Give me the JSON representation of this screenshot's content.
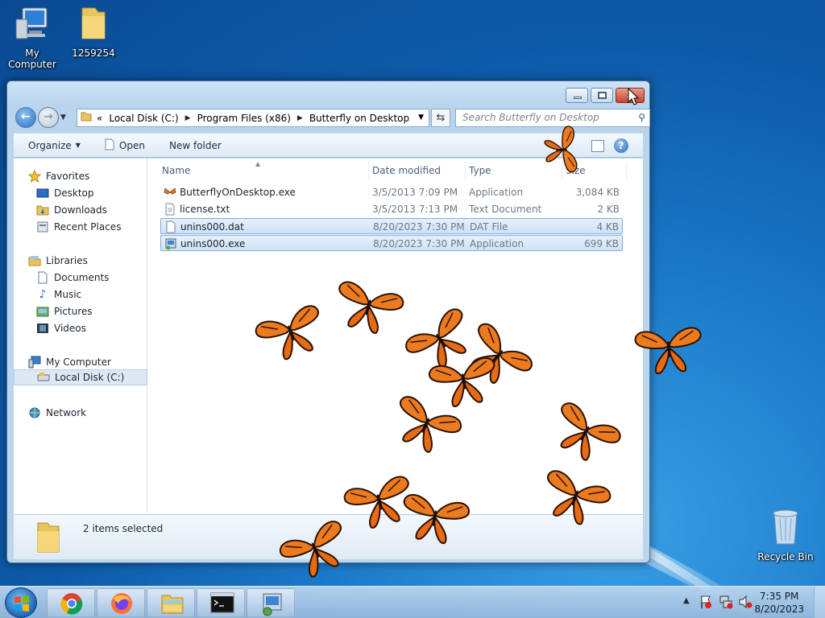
{
  "desktop": {
    "icons": [
      {
        "label": "My Computer",
        "icon": "computer-icon"
      },
      {
        "label": "1259254",
        "icon": "folder-icon"
      },
      {
        "label": "Recycle Bin",
        "icon": "recycle-bin-icon"
      }
    ]
  },
  "window": {
    "address": {
      "overflow": "«",
      "segments": [
        "Local Disk (C:)",
        "Program Files (x86)",
        "Butterfly on Desktop"
      ]
    },
    "search": {
      "placeholder": "Search Butterfly on Desktop"
    },
    "toolbar": {
      "organize": "Organize",
      "open": "Open",
      "new_folder": "New folder"
    },
    "nav": {
      "favorites": "Favorites",
      "desktop": "Desktop",
      "downloads": "Downloads",
      "recent": "Recent Places",
      "libraries": "Libraries",
      "documents": "Documents",
      "music": "Music",
      "pictures": "Pictures",
      "videos": "Videos",
      "computer": "My Computer",
      "local_disk": "Local Disk (C:)",
      "network": "Network"
    },
    "columns": {
      "name": "Name",
      "date": "Date modified",
      "type": "Type",
      "size": "Size"
    },
    "files": [
      {
        "name": "ButterflyOnDesktop.exe",
        "date": "3/5/2013 7:09 PM",
        "type": "Application",
        "size": "3,084 KB",
        "icon": "butterfly-app-icon",
        "selected": false
      },
      {
        "name": "license.txt",
        "date": "3/5/2013 7:13 PM",
        "type": "Text Document",
        "size": "2 KB",
        "icon": "text-file-icon",
        "selected": false
      },
      {
        "name": "unins000.dat",
        "date": "8/20/2023 7:30 PM",
        "type": "DAT File",
        "size": "4 KB",
        "icon": "file-icon",
        "selected": true
      },
      {
        "name": "unins000.exe",
        "date": "8/20/2023 7:30 PM",
        "type": "Application",
        "size": "699 KB",
        "icon": "installer-icon",
        "selected": true
      }
    ],
    "status": "2 items selected"
  },
  "taskbar": {
    "apps": [
      "chrome-icon",
      "firefox-icon",
      "file-explorer-icon",
      "command-prompt-icon",
      "installer-icon"
    ],
    "clock": {
      "time": "7:35 PM",
      "date": "8/20/2023"
    }
  },
  "colors": {
    "selection": "#cfe2f6",
    "butterfly": "#e8761c"
  }
}
